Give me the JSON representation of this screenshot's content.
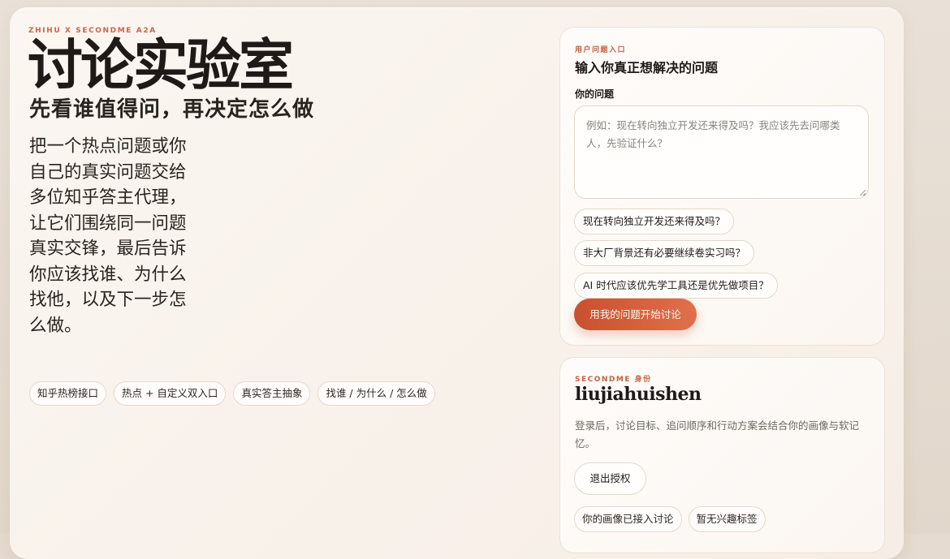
{
  "hero": {
    "eyebrow": "ZHIHU X SECONDME A2A",
    "title": "讨论实验室",
    "subtitle": "先看谁值得问，再决定怎么做",
    "description": "把一个热点问题或你自己的真实问题交给多位知乎答主代理，让它们围绕同一问题真实交锋，最后告诉你应该找谁、为什么找他，以及下一步怎么做。",
    "tags": [
      "知乎热榜接口",
      "热点 + 自定义双入口",
      "真实答主抽象",
      "找谁 / 为什么 / 怎么做"
    ]
  },
  "question_card": {
    "label": "用户问题入口",
    "title": "输入你真正想解决的问题",
    "field_label": "你的问题",
    "placeholder": "例如：现在转向独立开发还来得及吗？我应该先去问哪类人，先验证什么？",
    "value": "",
    "suggestions": [
      "现在转向独立开发还来得及吗？",
      "非大厂背景还有必要继续卷实习吗？",
      "AI 时代应该优先学工具还是优先做项目？"
    ],
    "submit_label": "用我的问题开始讨论"
  },
  "identity_card": {
    "label": "SECONDME 身份",
    "username": "liujiahuishen",
    "description": "登录后，讨论目标、追问顺序和行动方案会结合你的画像与软记忆。",
    "logout_label": "退出授权",
    "status_chips": [
      "你的画像已接入讨论",
      "暂无兴趣标签"
    ]
  },
  "colors": {
    "accent": "#d0573a",
    "background": "#fbf6f1",
    "text": "#1f1a17"
  }
}
